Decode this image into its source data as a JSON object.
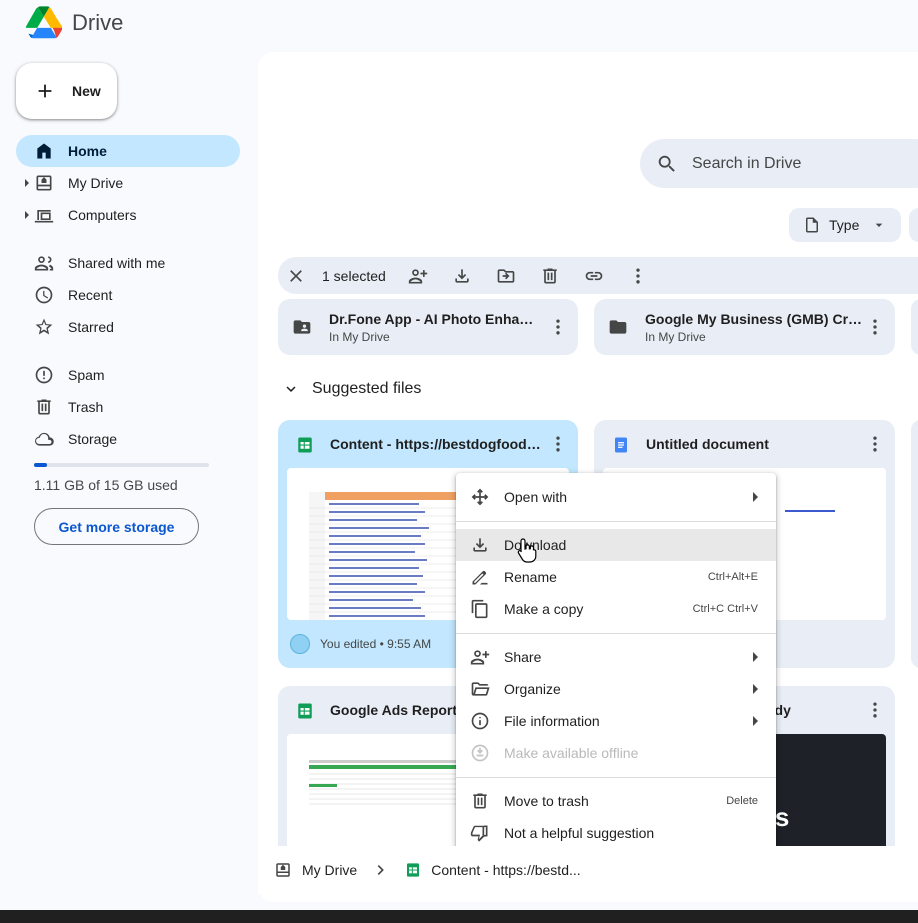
{
  "app": {
    "name": "Drive"
  },
  "sidebar": {
    "new_label": "New",
    "items": [
      {
        "label": "Home",
        "icon": "home-icon",
        "active": true
      },
      {
        "label": "My Drive",
        "icon": "my-drive-icon"
      },
      {
        "label": "Computers",
        "icon": "computers-icon"
      },
      {
        "label": "Shared with me",
        "icon": "shared-icon"
      },
      {
        "label": "Recent",
        "icon": "clock-icon"
      },
      {
        "label": "Starred",
        "icon": "star-icon"
      },
      {
        "label": "Spam",
        "icon": "spam-icon"
      },
      {
        "label": "Trash",
        "icon": "trash-icon"
      },
      {
        "label": "Storage",
        "icon": "cloud-icon"
      }
    ],
    "storage": {
      "used_text": "1.11 GB of 15 GB used",
      "used_fraction": 0.074,
      "button": "Get more storage"
    }
  },
  "search": {
    "placeholder": "Search in Drive"
  },
  "filters": {
    "type_label": "Type"
  },
  "selection": {
    "count_text": "1 selected"
  },
  "folders": [
    {
      "name": "Dr.Fone App - AI Photo Enhancer",
      "location": "In My Drive"
    },
    {
      "name": "Google My Business (GMB) Creati...",
      "location": "In My Drive"
    }
  ],
  "suggested": {
    "heading": "Suggested files",
    "files": [
      {
        "name": "Content - https://bestdogfoodfor...",
        "type": "sheets",
        "edited": "You edited • 9:55 AM"
      },
      {
        "name": "Untitled document",
        "type": "docs"
      },
      {
        "name": "Google Ads Report -",
        "type": "sheets"
      },
      {
        "name": "udy",
        "type": "slides",
        "thumb_text": "lts"
      }
    ]
  },
  "context_menu": {
    "items": [
      {
        "label": "Open with",
        "icon": "move-icon",
        "submenu": true
      },
      {
        "label": "Download",
        "icon": "download-icon",
        "hover": true
      },
      {
        "label": "Rename",
        "icon": "rename-icon",
        "shortcut": "Ctrl+Alt+E"
      },
      {
        "label": "Make a copy",
        "icon": "copy-icon",
        "shortcut": "Ctrl+C Ctrl+V"
      },
      {
        "label": "Share",
        "icon": "share-icon",
        "submenu": true
      },
      {
        "label": "Organize",
        "icon": "organize-icon",
        "submenu": true
      },
      {
        "label": "File information",
        "icon": "info-icon",
        "submenu": true
      },
      {
        "label": "Make available offline",
        "icon": "offline-icon",
        "disabled": true
      },
      {
        "label": "Move to trash",
        "icon": "trash-icon",
        "shortcut": "Delete"
      },
      {
        "label": "Not a helpful suggestion",
        "icon": "thumbs-down-icon"
      }
    ]
  },
  "breadcrumb": {
    "root": "My Drive",
    "file": "Content - https://bestd..."
  }
}
